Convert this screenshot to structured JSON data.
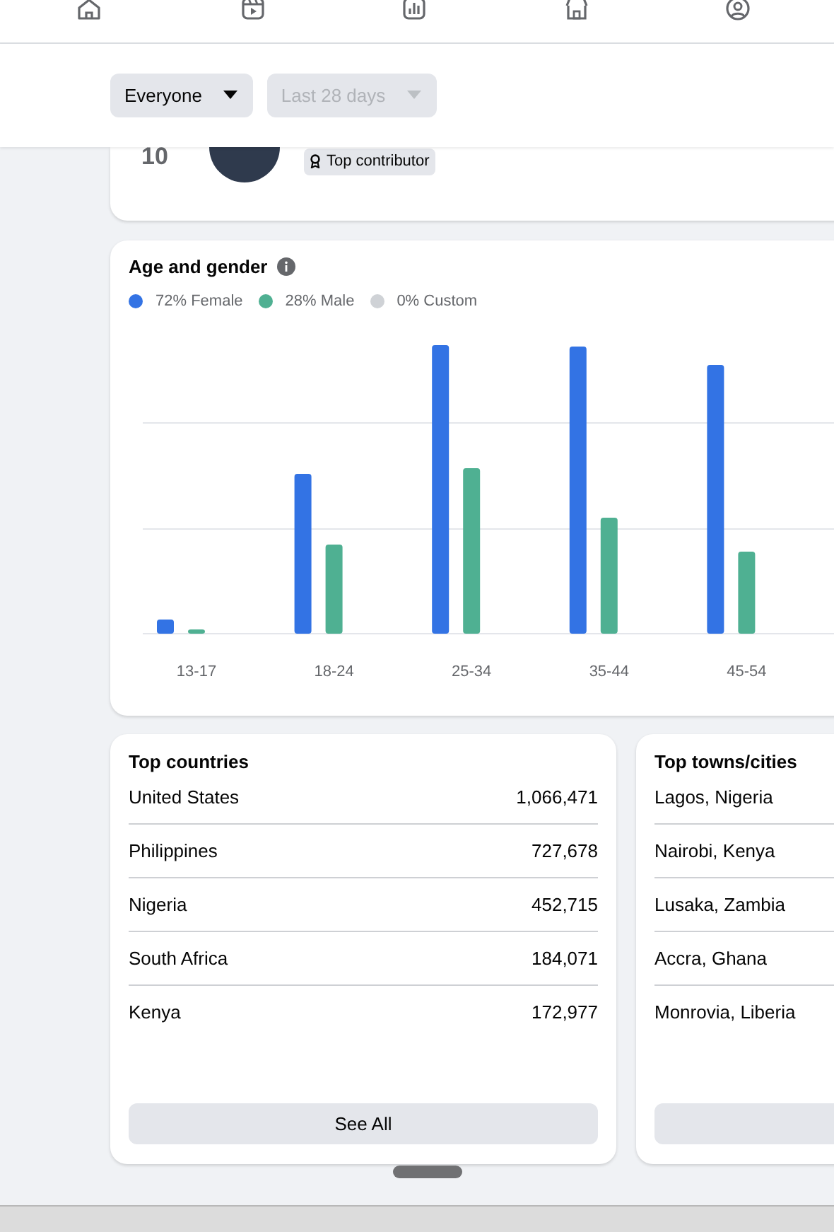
{
  "nav": {
    "tabs": [
      {
        "kind": "home",
        "selected": false
      },
      {
        "kind": "video",
        "selected": false
      },
      {
        "kind": "chart",
        "selected": false
      },
      {
        "kind": "store",
        "selected": false
      },
      {
        "kind": "profile",
        "selected": false
      }
    ]
  },
  "filters": [
    {
      "label": "Everyone",
      "disabled": false
    },
    {
      "label": "Last 28 days",
      "disabled": true
    }
  ],
  "contributor": {
    "rank": "10",
    "badge": "Top contributor"
  },
  "age_gender": {
    "title": "Age and gender",
    "legend": [
      {
        "label": "72% Female",
        "color": "#3373e4"
      },
      {
        "label": "28% Male",
        "color": "#4fb092"
      },
      {
        "label": "0% Custom",
        "color": "#cfd2d6"
      }
    ],
    "categories": [
      "13-17",
      "18-24",
      "25-34",
      "35-44",
      "45-54"
    ]
  },
  "top_countries": {
    "title": "Top countries",
    "rows": [
      {
        "name": "United States",
        "value": "1,066,471"
      },
      {
        "name": "Philippines",
        "value": "727,678"
      },
      {
        "name": "Nigeria",
        "value": "452,715"
      },
      {
        "name": "South Africa",
        "value": "184,071"
      },
      {
        "name": "Kenya",
        "value": "172,977"
      }
    ],
    "button": "See All"
  },
  "top_cities": {
    "title": "Top towns/cities",
    "rows": [
      {
        "name": "Lagos, Nigeria"
      },
      {
        "name": "Nairobi, Kenya"
      },
      {
        "name": "Lusaka, Zambia"
      },
      {
        "name": "Accra, Ghana"
      },
      {
        "name": "Monrovia, Liberia"
      }
    ]
  }
}
